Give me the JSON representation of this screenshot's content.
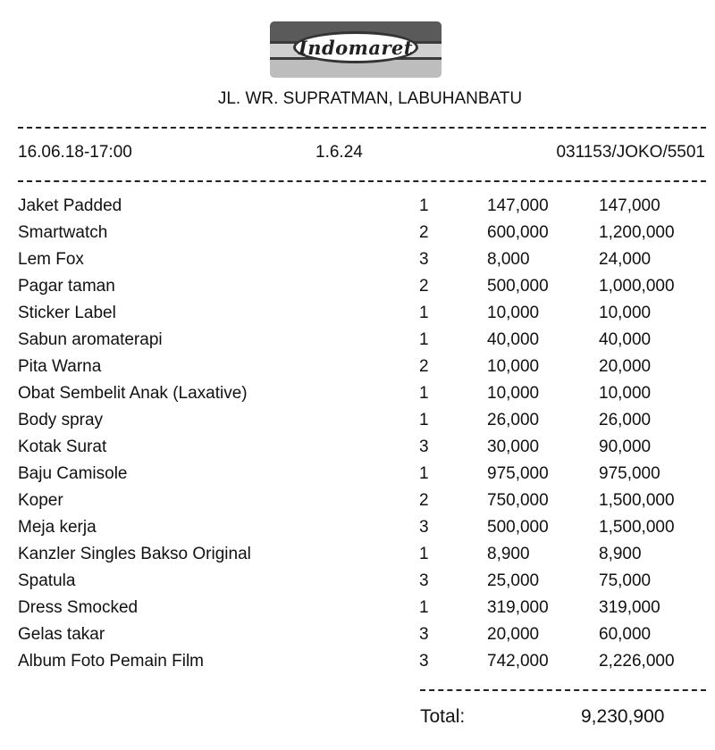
{
  "header": {
    "logo_text": "Indomaret",
    "address": "JL. WR. SUPRATMAN, LABUHANBATU"
  },
  "meta": {
    "datetime": "16.06.18-17:00",
    "version": "1.6.24",
    "cashier": "031153/JOKO/5501"
  },
  "items": [
    {
      "name": "Jaket Padded",
      "qty": "1",
      "price": "147,000",
      "total": "147,000"
    },
    {
      "name": "Smartwatch",
      "qty": "2",
      "price": "600,000",
      "total": "1,200,000"
    },
    {
      "name": "Lem Fox",
      "qty": "3",
      "price": "8,000",
      "total": "24,000"
    },
    {
      "name": "Pagar taman",
      "qty": "2",
      "price": "500,000",
      "total": "1,000,000"
    },
    {
      "name": "Sticker Label",
      "qty": "1",
      "price": "10,000",
      "total": "10,000"
    },
    {
      "name": "Sabun aromaterapi",
      "qty": "1",
      "price": "40,000",
      "total": "40,000"
    },
    {
      "name": "Pita Warna",
      "qty": "2",
      "price": "10,000",
      "total": "20,000"
    },
    {
      "name": "Obat Sembelit Anak (Laxative)",
      "qty": "1",
      "price": "10,000",
      "total": "10,000"
    },
    {
      "name": "Body spray",
      "qty": "1",
      "price": "26,000",
      "total": "26,000"
    },
    {
      "name": "Kotak Surat",
      "qty": "3",
      "price": "30,000",
      "total": "90,000"
    },
    {
      "name": "Baju Camisole",
      "qty": "1",
      "price": "975,000",
      "total": "975,000"
    },
    {
      "name": "Koper",
      "qty": "2",
      "price": "750,000",
      "total": "1,500,000"
    },
    {
      "name": "Meja kerja",
      "qty": "3",
      "price": "500,000",
      "total": "1,500,000"
    },
    {
      "name": "Kanzler Singles Bakso Original",
      "qty": "1",
      "price": "8,900",
      "total": "8,900"
    },
    {
      "name": "Spatula",
      "qty": "3",
      "price": "25,000",
      "total": "75,000"
    },
    {
      "name": "Dress Smocked",
      "qty": "1",
      "price": "319,000",
      "total": "319,000"
    },
    {
      "name": "Gelas takar",
      "qty": "3",
      "price": "20,000",
      "total": "60,000"
    },
    {
      "name": "Album Foto Pemain Film",
      "qty": "3",
      "price": "742,000",
      "total": "2,226,000"
    }
  ],
  "summary": {
    "total_label": "Total:",
    "total_value": "9,230,900"
  }
}
